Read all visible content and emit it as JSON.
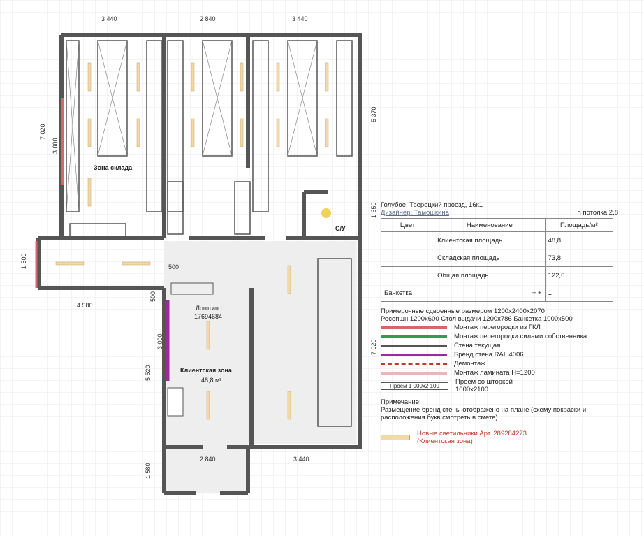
{
  "plan": {
    "dims": {
      "top": [
        "3 440",
        "2 840",
        "3 440"
      ],
      "left_total": "7 020",
      "left_a": "3 000",
      "left_b": "1 500",
      "left_c": "4 580",
      "left_d": "500",
      "left_e": "500",
      "left_f": "3 000",
      "left_g": "5 520",
      "left_h": "1 580",
      "bottom": [
        "2 840",
        "3 440"
      ],
      "right_a": "5 370",
      "right_b": "1 650",
      "right_c": "7 020"
    },
    "labels": {
      "storage_zone": "Зона склада",
      "wc": "С/У",
      "logo_line1": "Логотип I",
      "logo_line2": "17694684",
      "client_zone": "Клиентская зона",
      "client_area": "48,8 м²"
    }
  },
  "legend": {
    "address": "Голубое, Тверецкий проезд, 16к1",
    "ceiling": "h потолка 2,8",
    "designer": "Дизайнер: Тамошкина",
    "table_headers": [
      "Цвет",
      "Наименование",
      "Площадь/м²"
    ],
    "table_rows": [
      {
        "name": "Клиентская площадь",
        "value": "48,8"
      },
      {
        "name": "Складская площадь",
        "value": "73,8"
      },
      {
        "name": "Общая площадь",
        "value": "122,6"
      }
    ],
    "banketka_label": "Банкетка",
    "banketka_symbol": "+ +",
    "banketka_value": "1",
    "sizes_line1": "Примерочные сдвоенные размером 1200x2400x2070",
    "sizes_line2": "Ресепшн 1200x600    Стол выдачи 1200x786   Банкетка 1000x500",
    "items": [
      {
        "color": "#d9646c",
        "label": "Монтаж перегородки из ГКЛ"
      },
      {
        "color": "#2e9e55",
        "label": "Монтаж перегородки силами собственника"
      },
      {
        "color": "#555555",
        "label": "Стена текущая"
      },
      {
        "color": "#9b2ca0",
        "label": "Бренд стена RAL 4006"
      },
      {
        "color": "dash",
        "label": "Демонтаж"
      },
      {
        "color": "#e6b8b8",
        "label": "Монтаж ламината H=1200"
      }
    ],
    "opening_label": "Проем со шторкой",
    "opening_size": "1000x2100",
    "opening_box": "Проем  1 000x2 100",
    "note_title": "Примечание:",
    "note_text": "Размещение бренд стены отображено на плане (схему покраски и расположения букв смотреть в смете)",
    "lights_line1": "Новые светильники Арт. 289284273",
    "lights_line2": "(Клиентская зона)",
    "lights_color": "#f2d9a8",
    "text_accent": "#c0392b"
  }
}
